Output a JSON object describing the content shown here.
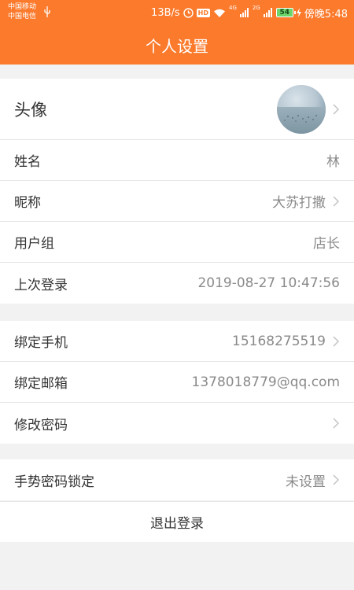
{
  "status_bar": {
    "carrier1": "中国移动",
    "carrier2": "中国电信",
    "speed": "13B/s",
    "hd": "HD",
    "net1": "4G",
    "net2": "2G",
    "battery": "54",
    "time": "傍晚5:48"
  },
  "header": {
    "title": "个人设置"
  },
  "profile": {
    "avatar_label": "头像",
    "name_label": "姓名",
    "name_value": "林",
    "nickname_label": "昵称",
    "nickname_value": "大苏打撒",
    "group_label": "用户组",
    "group_value": "店长",
    "last_login_label": "上次登录",
    "last_login_value": "2019-08-27 10:47:56"
  },
  "account": {
    "phone_label": "绑定手机",
    "phone_value": "15168275519",
    "email_label": "绑定邮箱",
    "email_value": "1378018779@qq.com",
    "password_label": "修改密码"
  },
  "security": {
    "gesture_label": "手势密码锁定",
    "gesture_value": "未设置"
  },
  "logout_label": "退出登录",
  "colors": {
    "accent": "#fb7a2c",
    "background": "#f2f2f2"
  }
}
